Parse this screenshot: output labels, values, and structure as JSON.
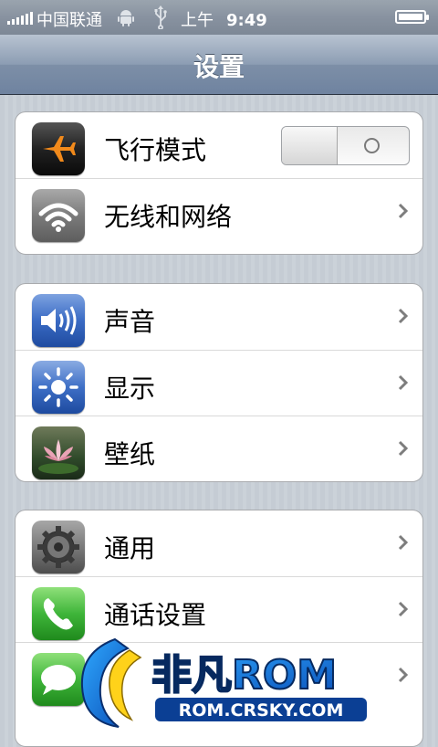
{
  "status_bar": {
    "carrier": "中国联通",
    "period": "上午",
    "time": "9:49",
    "icons": [
      "signal-icon",
      "android-icon",
      "usb-icon",
      "battery-icon"
    ]
  },
  "nav": {
    "title": "设置"
  },
  "groups": [
    {
      "items": [
        {
          "label": "飞行模式",
          "icon": "airplane-icon",
          "control": "toggle",
          "toggle_state": "off",
          "toggle_symbol": "O"
        },
        {
          "label": "无线和网络",
          "icon": "wifi-icon",
          "control": "chevron"
        }
      ]
    },
    {
      "items": [
        {
          "label": "声音",
          "icon": "speaker-icon",
          "control": "chevron"
        },
        {
          "label": "显示",
          "icon": "brightness-icon",
          "control": "chevron"
        },
        {
          "label": "壁纸",
          "icon": "wallpaper-lotus-icon",
          "control": "chevron"
        }
      ]
    },
    {
      "items": [
        {
          "label": "通用",
          "icon": "gear-icon",
          "control": "chevron"
        },
        {
          "label": "通话设置",
          "icon": "phone-icon",
          "control": "chevron"
        },
        {
          "label": "",
          "icon": "messages-icon",
          "control": "chevron"
        }
      ]
    }
  ],
  "watermark": {
    "brand": "非凡ROM",
    "url": "ROM.CRSKY.COM"
  },
  "colors": {
    "nav_gradient_top": "#b8c3d1",
    "nav_gradient_bottom": "#6f83a0",
    "background_stripe": "#c5ccd4",
    "airplane_orange": "#f28a1b",
    "speaker_blue": "#3a6bc4",
    "phone_green": "#3fb53a"
  }
}
